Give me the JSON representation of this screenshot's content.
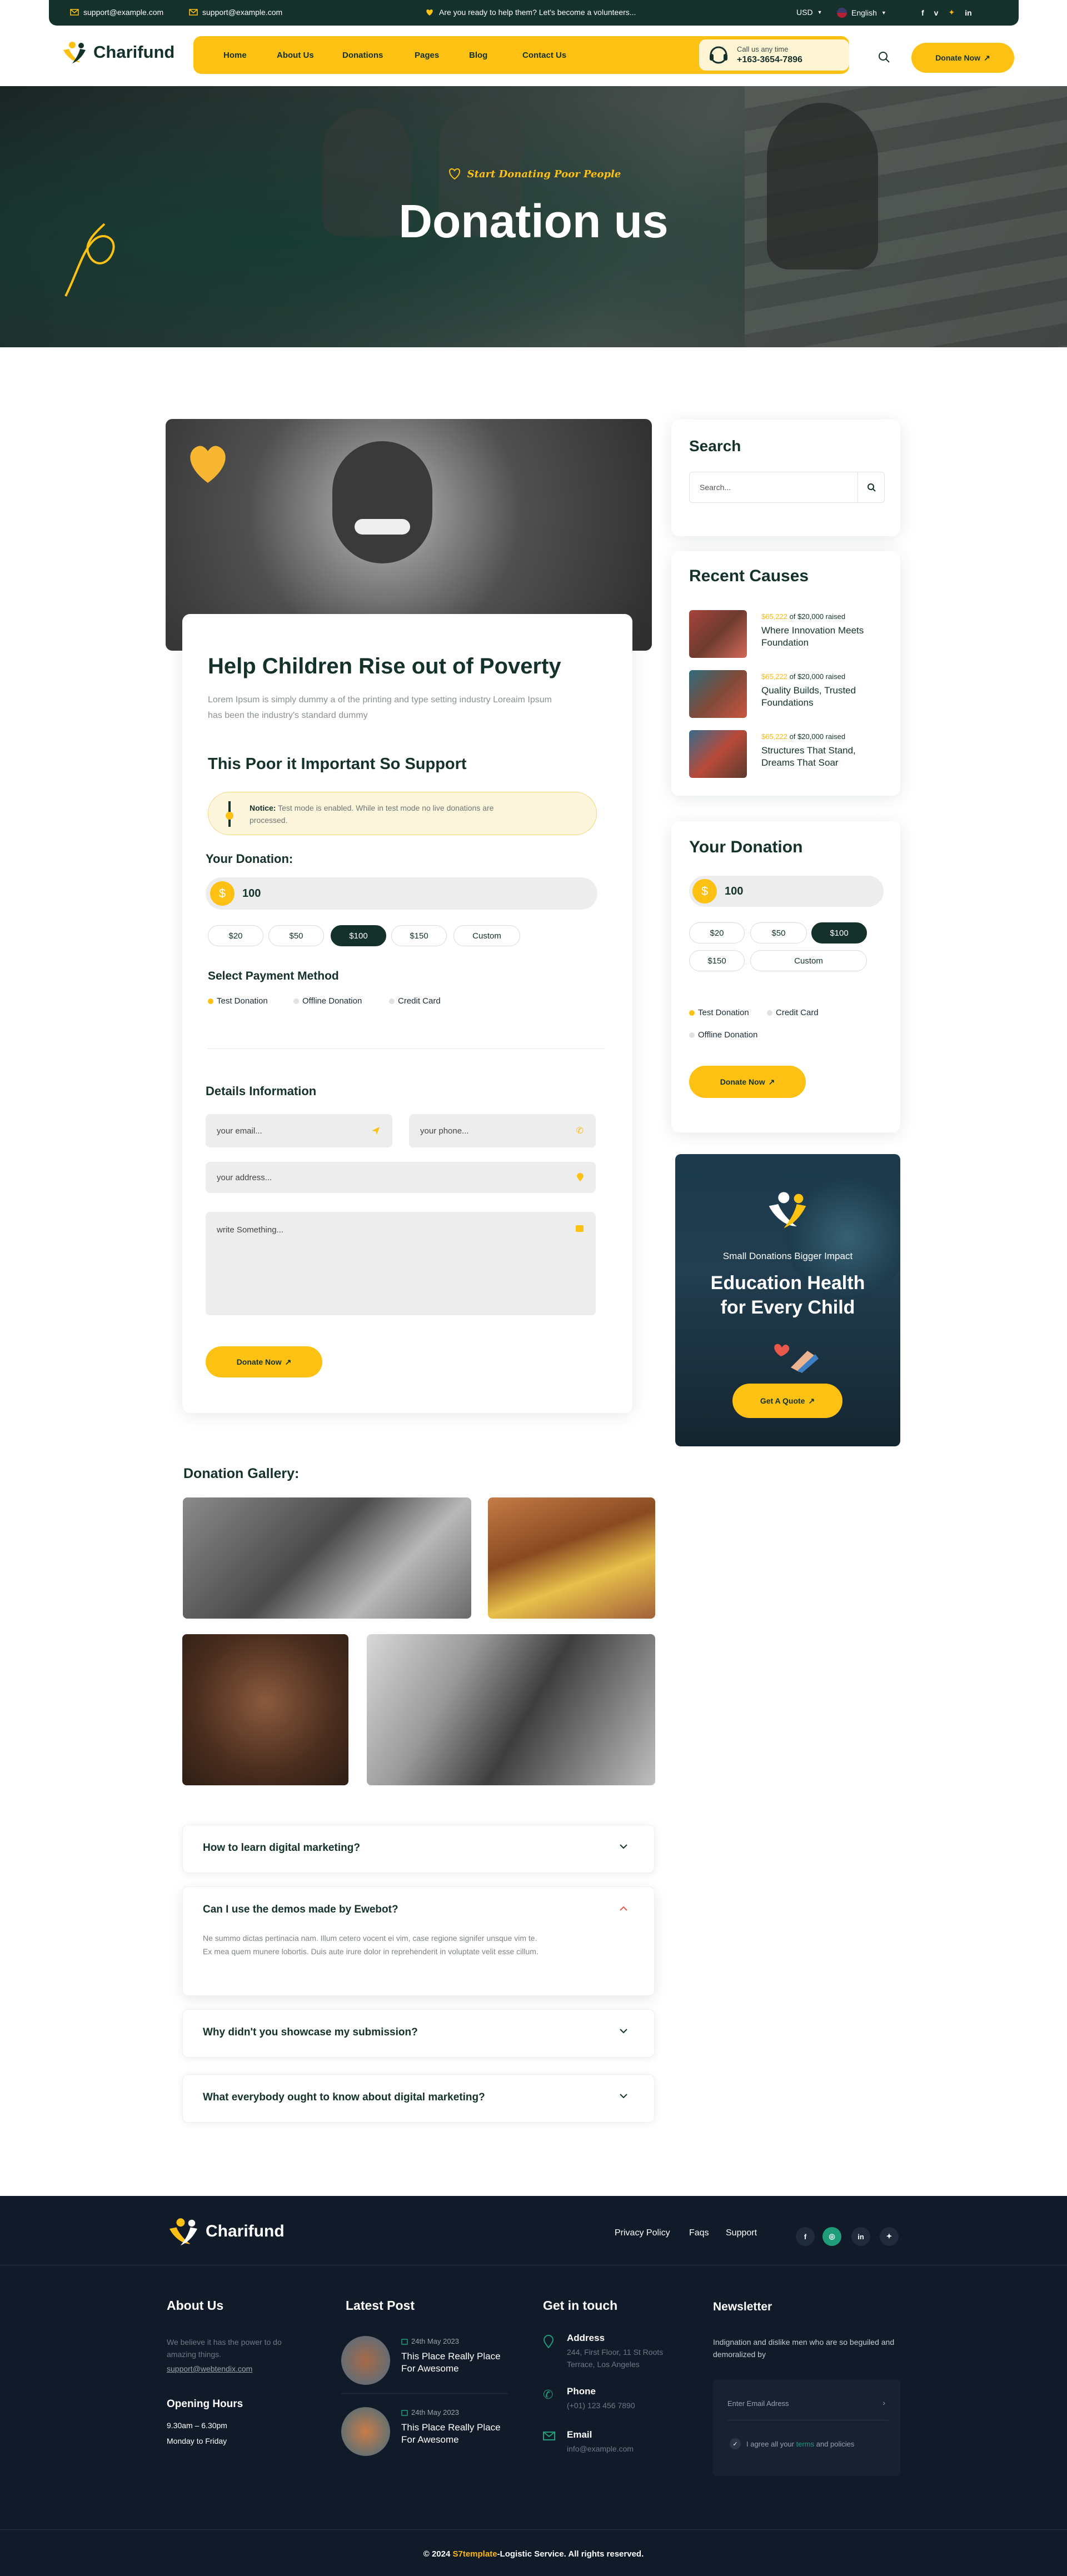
{
  "topbar": {
    "email1": "support@example.com",
    "email2": "support@example.com",
    "announcement": "Are you ready to help them? Let's become a volunteers...",
    "currency": "USD",
    "language": "English"
  },
  "header": {
    "logo": "Charifund",
    "nav": [
      "Home",
      "About Us",
      "Donations",
      "Pages",
      "Blog",
      "Contact Us"
    ],
    "call_label": "Call us any time",
    "phone": "+163-3654-7896",
    "donate_button": "Donate Now"
  },
  "hero": {
    "tagline": "Start Donating Poor People",
    "title": "Donation us"
  },
  "main": {
    "title": "Help Children Rise out of Poverty",
    "intro": "Lorem Ipsum is simply dummy a of the printing and type setting industry Loreaim Ipsum has been the industry's standard dummy",
    "support_heading": "This Poor it Important So Support",
    "notice_label": "Notice:",
    "notice_text": "Test mode is enabled. While in test mode no live donations are processed.",
    "donation_label": "Your Donation:",
    "currency_symbol": "$",
    "amount": "100",
    "amounts": [
      "$20",
      "$50",
      "$100",
      "$150",
      "Custom"
    ],
    "payment_heading": "Select Payment Method",
    "payment_methods": [
      "Test Donation",
      "Offline Donation",
      "Credit Card"
    ],
    "details_heading": "Details Information",
    "email_placeholder": "your email...",
    "phone_placeholder": "your phone...",
    "address_placeholder": "your address...",
    "message_placeholder": "write Something...",
    "donate_button": "Donate Now"
  },
  "sidebar": {
    "search_title": "Search",
    "search_placeholder": "Search...",
    "recent_title": "Recent Causes",
    "causes": [
      {
        "raised": "$65,222",
        "goal": "of $20,000 raised",
        "title": "Where Innovation Meets Foundation"
      },
      {
        "raised": "$65,222",
        "goal": "of $20,000 raised",
        "title": "Quality Builds, Trusted Foundations"
      },
      {
        "raised": "$65,222",
        "goal": "of $20,000 raised",
        "title": "Structures That Stand, Dreams That Soar"
      }
    ],
    "donation_title": "Your Donation",
    "currency_symbol": "$",
    "amount": "100",
    "amounts": [
      "$20",
      "$50",
      "$100",
      "$150",
      "Custom"
    ],
    "payment_methods": [
      "Test Donation",
      "Credit Card",
      "Offline Donation"
    ],
    "donate_button": "Donate Now",
    "promo_small": "Small Donations Bigger Impact",
    "promo_title": "Education Health for Every Child",
    "promo_button": "Get A Quote"
  },
  "gallery": {
    "title": "Donation Gallery:"
  },
  "faqs": [
    {
      "q": "How to learn digital marketing?",
      "a": ""
    },
    {
      "q": "Can I use the demos made by Ewebot?",
      "a": "Ne summo dictas pertinacia nam. Illum cetero vocent ei vim, case regione signifer unsque vim te. Ex mea quem munere lobortis. Duis aute irure dolor in reprehenderit in voluptate velit esse cillum."
    },
    {
      "q": "Why didn't you showcase my submission?",
      "a": ""
    },
    {
      "q": "What everybody ought to know about digital marketing?",
      "a": ""
    }
  ],
  "footer": {
    "logo": "Charifund",
    "links": [
      "Privacy Policy",
      "Faqs",
      "Support"
    ],
    "social": [
      "f",
      "ig",
      "in",
      "tw"
    ],
    "about_title": "About Us",
    "about_text": "We believe it has the power to do amazing things.",
    "about_email": "support@webtendix.com",
    "hours_title": "Opening Hours",
    "hours_time": "9.30am – 6.30pm",
    "hours_days": "Monday to Friday",
    "posts_title": "Latest Post",
    "posts": [
      {
        "date": "24th May 2023",
        "title": "This Place Really Place For Awesome"
      },
      {
        "date": "24th May 2023",
        "title": "This Place Really Place For Awesome"
      }
    ],
    "contact_title": "Get in touch",
    "address_label": "Address",
    "address": "244, First Floor, 11 St Roots Terrace, Los Angeles",
    "phone_label": "Phone",
    "phone": "(+01) 123 456 7890",
    "email_label": "Email",
    "email": "info@example.com",
    "newsletter_title": "Newsletter",
    "newsletter_text": "Indignation and dislike men who are so beguiled and demoralized by",
    "newsletter_placeholder": "Enter Email Adress",
    "agree_prefix": "I agree all your",
    "agree_link": "terms",
    "agree_suffix": "and policies",
    "copyright_prefix": "© 2024",
    "copyright_brand": "S7template",
    "copyright_suffix": "-Logistic Service. All rights reserved."
  },
  "colors": {
    "accent": "#fdc113",
    "dark_green": "#14312b",
    "footer_bg": "#111a28"
  }
}
